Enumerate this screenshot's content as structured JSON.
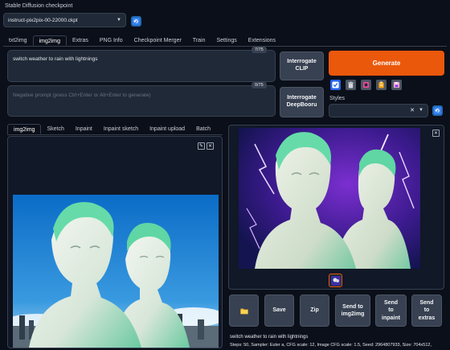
{
  "checkpoint": {
    "label": "Stable Diffusion checkpoint",
    "value": "instruct-pix2pix-00-22000.ckpt"
  },
  "main_tabs": [
    {
      "label": "txt2img",
      "active": false
    },
    {
      "label": "img2img",
      "active": true
    },
    {
      "label": "Extras",
      "active": false
    },
    {
      "label": "PNG Info",
      "active": false
    },
    {
      "label": "Checkpoint Merger",
      "active": false
    },
    {
      "label": "Train",
      "active": false
    },
    {
      "label": "Settings",
      "active": false
    },
    {
      "label": "Extensions",
      "active": false
    }
  ],
  "prompt": {
    "value": "switch weather to rain with lightnings",
    "counter": "7/75"
  },
  "negative_prompt": {
    "placeholder": "Negative prompt (press Ctrl+Enter or Alt+Enter to generate)",
    "counter": "0/75"
  },
  "buttons": {
    "interrogate_clip": [
      "Interrogate",
      "CLIP"
    ],
    "interrogate_deepbooru": [
      "Interrogate",
      "DeepBooru"
    ],
    "generate": "Generate"
  },
  "styles": {
    "label": "Styles",
    "value": ""
  },
  "sub_tabs": [
    {
      "label": "img2img",
      "active": true
    },
    {
      "label": "Sketch",
      "active": false
    },
    {
      "label": "Inpaint",
      "active": false
    },
    {
      "label": "Inpaint sketch",
      "active": false
    },
    {
      "label": "Inpaint upload",
      "active": false
    },
    {
      "label": "Batch",
      "active": false
    }
  ],
  "actions": {
    "save": "Save",
    "zip": "Zip",
    "send_img2img": [
      "Send to",
      "img2img"
    ],
    "send_inpaint": [
      "Send",
      "to",
      "inpaint"
    ],
    "send_extras": [
      "Send",
      "to",
      "extras"
    ]
  },
  "output_info": {
    "prompt": "switch weather to rain with lightnings",
    "params": "Steps: 50, Sampler: Euler a, CFG scale: 12, Image CFG scale: 1.5, Seed: 2964807933, Size: 704x512,"
  },
  "colors": {
    "background": "#0b0f19",
    "accent": "#ea580c",
    "blue": "#1f6bb3"
  },
  "icons": {
    "refresh": "refresh-icon",
    "folder": "folder-icon",
    "trash": "trash-icon",
    "clipboard": "clipboard-icon",
    "magenta_square": "apply-style-icon",
    "save_style": "save-style-icon",
    "checkbox": "checkbox-icon"
  }
}
